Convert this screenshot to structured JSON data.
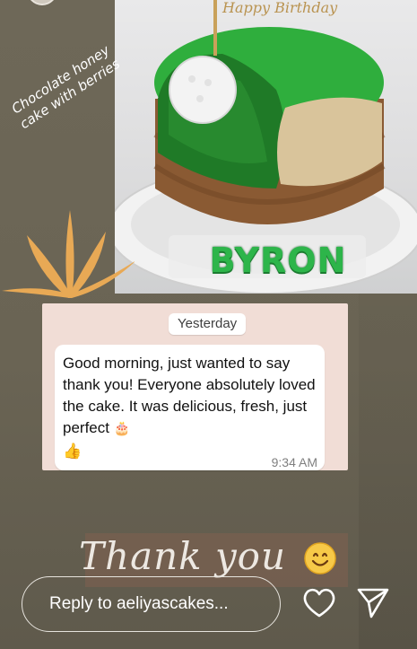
{
  "story": {
    "caption": "Chocolate honey cake with berries",
    "photo": {
      "cake_topper": "Happy Birthday",
      "cake_name": "BYRON",
      "colors": {
        "icing": "#2fae3d",
        "crust": "#8a5a33",
        "board": "#d9d9d9"
      }
    },
    "chat": {
      "date_label": "Yesterday",
      "message_text": "Good morning, just wanted to say thank you! Everyone absolutely loved the cake. It was delicious, fresh, just perfect",
      "message_emoji": "🎂",
      "message_emoji_2": "👍",
      "time": "9:34 AM"
    },
    "thanks": {
      "text": "Thank you",
      "emoji_icon": "smiley-icon"
    }
  },
  "reply_bar": {
    "placeholder": "Reply to aeliyascakes...",
    "like_icon": "heart-icon",
    "send_icon": "send-icon"
  },
  "colors": {
    "background": "#6b6556",
    "chat_background": "#f1ddd6",
    "accent_leaf": "#e8a955"
  }
}
